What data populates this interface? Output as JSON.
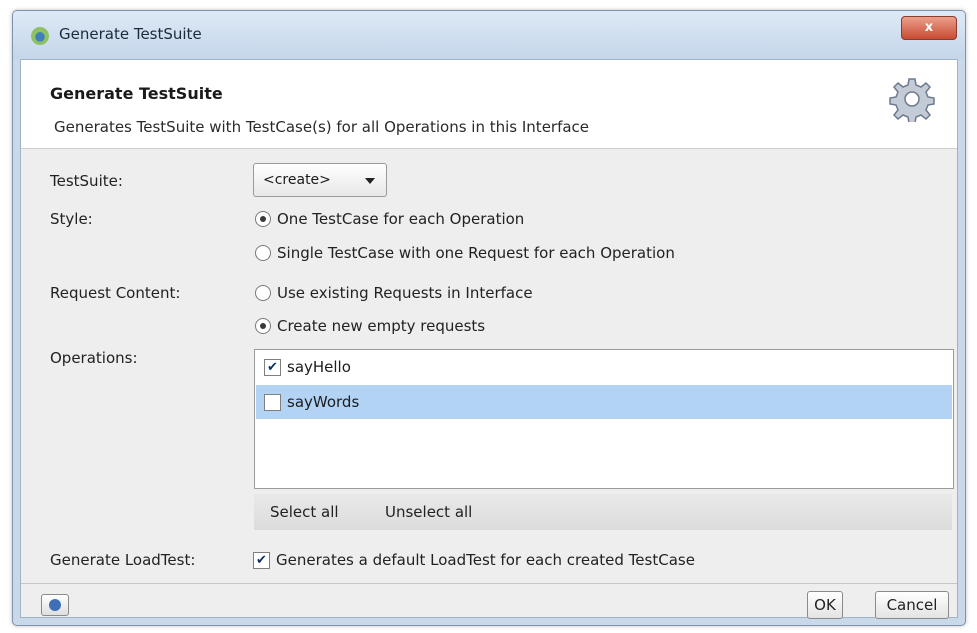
{
  "window": {
    "title": "Generate TestSuite",
    "close_label": "x"
  },
  "header": {
    "title": "Generate TestSuite",
    "description": "Generates TestSuite with TestCase(s) for all Operations in this Interface"
  },
  "form": {
    "testsuite": {
      "label": "TestSuite:",
      "value": "<create>"
    },
    "style": {
      "label": "Style:",
      "options": [
        {
          "label": "One TestCase for each Operation",
          "selected": true
        },
        {
          "label": "Single TestCase with one Request for each Operation",
          "selected": false
        }
      ]
    },
    "request_content": {
      "label": "Request Content:",
      "options": [
        {
          "label": "Use existing Requests in Interface",
          "selected": false
        },
        {
          "label": "Create new empty requests",
          "selected": true
        }
      ]
    },
    "operations": {
      "label": "Operations:",
      "items": [
        {
          "label": "sayHello",
          "checked": true,
          "highlighted": false
        },
        {
          "label": "sayWords",
          "checked": false,
          "highlighted": true
        }
      ],
      "select_all": "Select all",
      "unselect_all": "Unselect all"
    },
    "loadtest": {
      "label": "Generate LoadTest:",
      "checkbox_label": "Generates a default LoadTest for each created TestCase",
      "checked": true
    }
  },
  "footer": {
    "ok": "OK",
    "cancel": "Cancel"
  },
  "colors": {
    "selection": "#b3d3f4",
    "close_button": "#c94a32",
    "titlebar": "#c4d6ea"
  }
}
